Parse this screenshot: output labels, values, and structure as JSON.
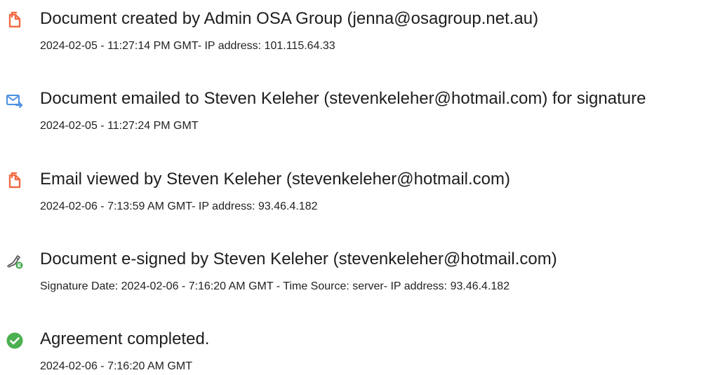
{
  "audit_trail": {
    "events": [
      {
        "icon": "document-created-icon",
        "title": "Document created by Admin OSA Group (jenna@osagroup.net.au)",
        "meta": "2024-02-05 - 11:27:14 PM GMT- IP address: 101.115.64.33"
      },
      {
        "icon": "email-sent-icon",
        "title": "Document emailed to Steven Keleher (stevenkeleher@hotmail.com) for signature",
        "meta": "2024-02-05 - 11:27:24 PM GMT"
      },
      {
        "icon": "email-viewed-icon",
        "title": "Email viewed by Steven Keleher (stevenkeleher@hotmail.com)",
        "meta": "2024-02-06 - 7:13:59 AM GMT- IP address: 93.46.4.182"
      },
      {
        "icon": "e-signed-pen-icon",
        "title": "Document e-signed by Steven Keleher (stevenkeleher@hotmail.com)",
        "meta": "Signature Date: 2024-02-06 - 7:16:20 AM GMT - Time Source: server- IP address: 93.46.4.182"
      },
      {
        "icon": "completed-check-icon",
        "title": "Agreement completed.",
        "meta": "2024-02-06 - 7:16:20 AM GMT"
      }
    ]
  },
  "colors": {
    "document_icon": "#f26b46",
    "email_icon": "#4a90e2",
    "check_icon": "#4caf50",
    "title_text": "#1e1e1e",
    "meta_text": "#222222"
  }
}
